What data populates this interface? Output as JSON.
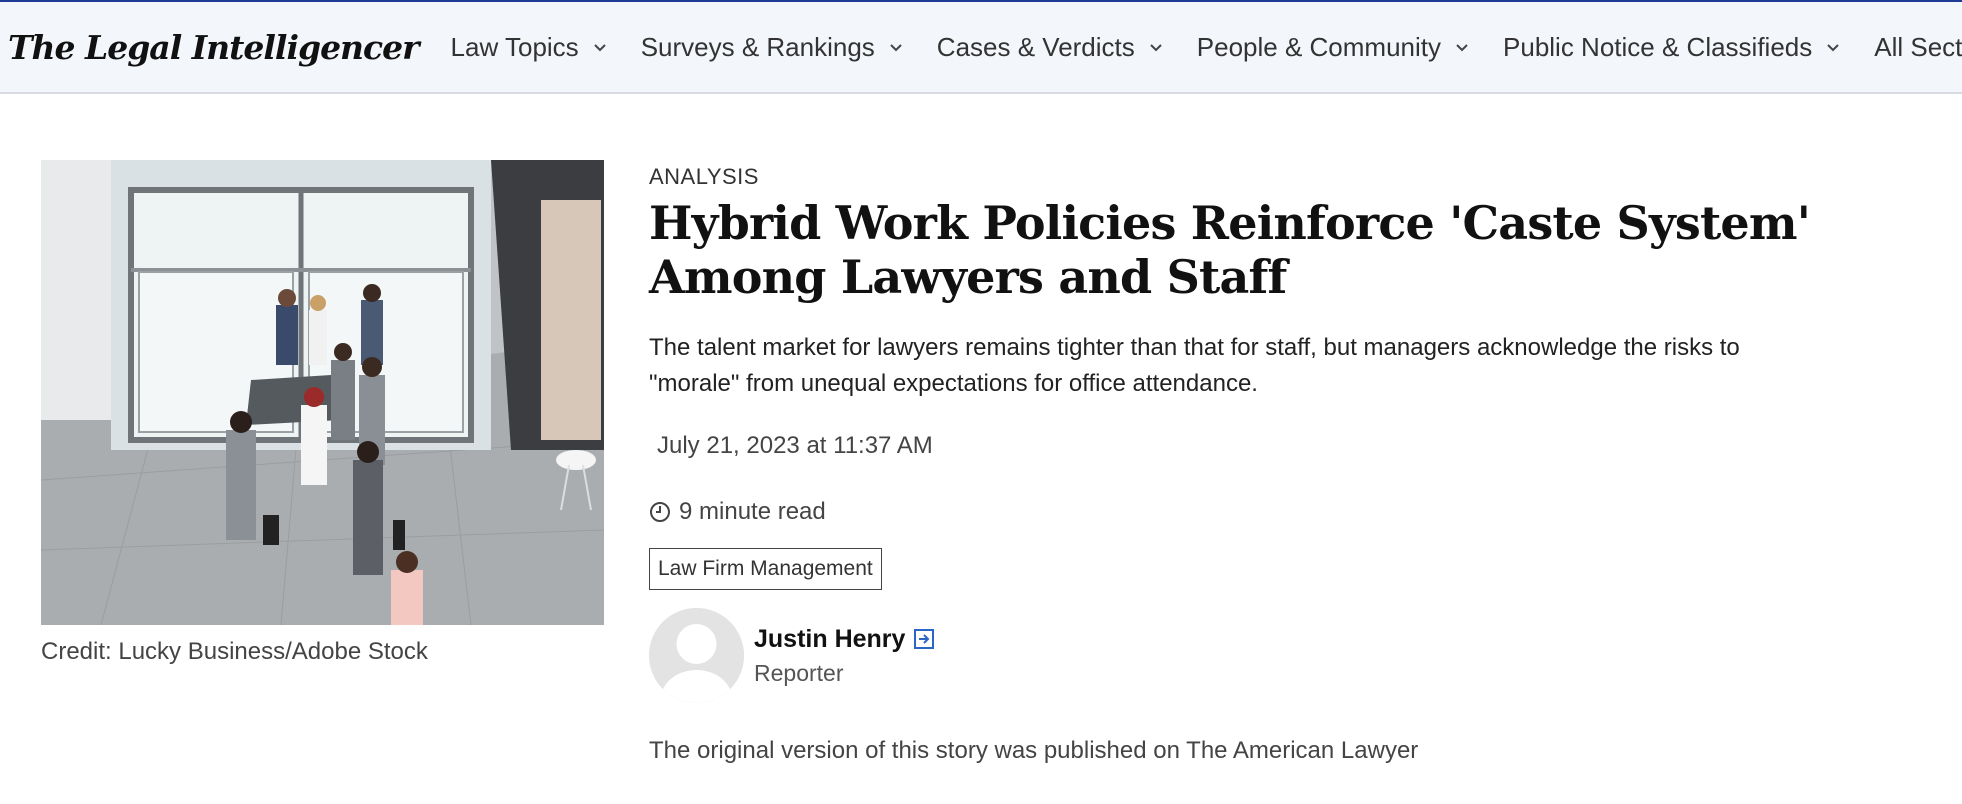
{
  "site": {
    "logo_text": "The Legal Intelligencer"
  },
  "nav": {
    "items": [
      {
        "label": "Law Topics"
      },
      {
        "label": "Surveys & Rankings"
      },
      {
        "label": "Cases & Verdicts"
      },
      {
        "label": "People & Community"
      },
      {
        "label": "Public Notice & Classifieds"
      },
      {
        "label": "All Sections"
      }
    ]
  },
  "image": {
    "credit": "Credit: Lucky Business/Adobe Stock"
  },
  "article": {
    "kicker": "ANALYSIS",
    "headline": "Hybrid Work Policies Reinforce 'Caste System' Among Lawyers and Staff",
    "dek": "The talent market for lawyers remains tighter than that for staff, but managers acknowledge the risks to \"morale\" from unequal expectations for office attendance.",
    "date": "July 21, 2023 at 11:37 AM",
    "read_time": "9 minute read",
    "tag": "Law Firm Management",
    "author": {
      "name": "Justin Henry",
      "role": "Reporter"
    },
    "origin_note": "The original version of this story was published on The American Lawyer"
  },
  "icons": {
    "nav_chevron": "chevron-down-icon",
    "clock": "clock-icon",
    "follow": "arrow-right-box-icon"
  },
  "colors": {
    "accent": "#1f3a93",
    "nav_bg": "#f3f6fb",
    "link_icon": "#2a66c8"
  }
}
